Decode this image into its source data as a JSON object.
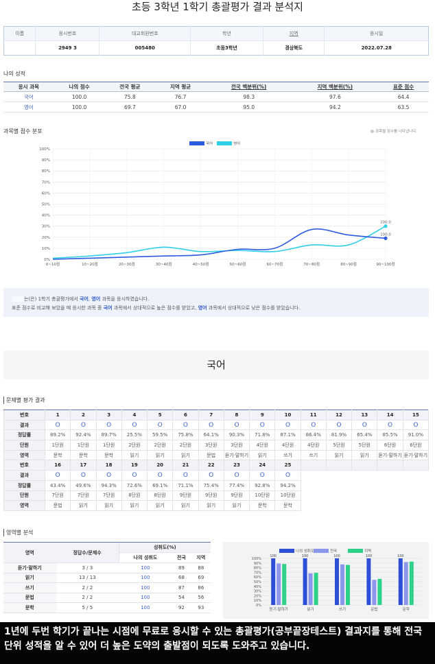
{
  "page_title": "초등 3학년 1학기 총괄평가 결과 분석지",
  "student_info": {
    "headers": [
      "이름",
      "응시번호",
      "대교회원번호",
      "학년",
      "지역",
      "응시일"
    ],
    "values": [
      "",
      "2949 3",
      "005480",
      "초등3학년",
      "경상북도",
      "2022.07.28"
    ]
  },
  "my_scores": {
    "label": "나의 성적",
    "headers": [
      "응시 과목",
      "나의 점수",
      "전국 평균",
      "지역 평균",
      "전국 백분위(%)",
      "지역 백분위(%)",
      "표준 점수"
    ],
    "rows": [
      [
        "국어",
        "100.0",
        "75.8",
        "76.7",
        "98.3",
        "97.6",
        "64.4"
      ],
      [
        "영어",
        "100.0",
        "69.7",
        "67.0",
        "95.0",
        "94.2",
        "63.5"
      ]
    ]
  },
  "distribution": {
    "label": "과목별 점수 분포",
    "note": "과목별 점수를 나타냅니다."
  },
  "chart_data": {
    "type": "line",
    "title": "",
    "categories": [
      "0~10점",
      "10~20점",
      "20~30점",
      "30~40점",
      "40~50점",
      "50~60점",
      "60~70점",
      "70~80점",
      "80~90점",
      "90~100점"
    ],
    "y_ticks": [
      "0%",
      "10%",
      "20%",
      "30%",
      "40%",
      "50%",
      "60%",
      "70%",
      "80%",
      "90%",
      "100%"
    ],
    "ylim": [
      0,
      100
    ],
    "grid": true,
    "legend": "top-center",
    "series": [
      {
        "name": "국어",
        "color": "#2d5be0",
        "values": [
          0,
          1,
          2,
          3,
          4,
          9,
          10,
          27,
          22,
          19
        ],
        "end_label": "100.0"
      },
      {
        "name": "영어",
        "color": "#30cfe8",
        "values": [
          1,
          3,
          6,
          11,
          7,
          8,
          7,
          13,
          13,
          30
        ],
        "end_label": "100.0"
      }
    ]
  },
  "summary": {
    "line1_a": "는(은) 1학기 총괄평가에서 ",
    "line1_s1": "국어",
    "line1_sep": ", ",
    "line1_s2": "영어",
    "line1_b": " 과목을 응시하였습니다.",
    "line2_a": "표준 점수로 비교해 보았을 때 응시한 과목 중 ",
    "line2_s1": "국어",
    "line2_b": " 과목에서 상대적으로 높은 점수를 받았고, ",
    "line2_s2": "영어",
    "line2_c": " 과목에서 상대적으로 낮은 점수를 받았습니다."
  },
  "subject_title": "국어",
  "problem_section": {
    "label": "문제별 평가 결과",
    "row_headers": [
      "번호",
      "결과",
      "정답률",
      "단원",
      "영역"
    ],
    "block1": {
      "numbers": [
        "1",
        "2",
        "3",
        "4",
        "5",
        "6",
        "7",
        "8",
        "9",
        "10",
        "11",
        "12",
        "13",
        "14",
        "15"
      ],
      "results": [
        "O",
        "O",
        "O",
        "O",
        "O",
        "O",
        "O",
        "O",
        "O",
        "O",
        "O",
        "O",
        "O",
        "O",
        "O"
      ],
      "rates": [
        "89.2%",
        "92.4%",
        "89.7%",
        "25.5%",
        "59.5%",
        "75.8%",
        "64.1%",
        "90.3%",
        "71.8%",
        "87.1%",
        "86.4%",
        "81.9%",
        "65.4%",
        "85.5%",
        "91.0%"
      ],
      "units": [
        "1단원",
        "1단원",
        "1단원",
        "2단원",
        "2단원",
        "2단원",
        "3단원",
        "3단원",
        "4단원",
        "4단원",
        "4단원",
        "5단원",
        "5단원",
        "6단원",
        "6단원"
      ],
      "areas": [
        "문학",
        "문학",
        "문학",
        "읽기",
        "읽기",
        "읽기",
        "문법",
        "듣기·말하기",
        "읽기",
        "쓰기",
        "쓰기",
        "읽기",
        "읽기",
        "듣기·말하기",
        "듣기·말하기"
      ]
    },
    "block2": {
      "numbers": [
        "16",
        "17",
        "18",
        "19",
        "20",
        "21",
        "22",
        "23",
        "24",
        "25"
      ],
      "results": [
        "O",
        "O",
        "O",
        "O",
        "O",
        "O",
        "O",
        "O",
        "O",
        "O"
      ],
      "rates": [
        "43.4%",
        "49.6%",
        "94.3%",
        "72.6%",
        "69.1%",
        "71.1%",
        "75.4%",
        "77.4%",
        "92.8%",
        "94.2%"
      ],
      "units": [
        "7단원",
        "7단원",
        "7단원",
        "8단원",
        "8단원",
        "9단원",
        "9단원",
        "9단원",
        "10단원",
        "10단원"
      ],
      "areas": [
        "문법",
        "읽기",
        "읽기",
        "읽기",
        "읽기",
        "읽기",
        "읽기",
        "읽기",
        "문학",
        "문학"
      ]
    }
  },
  "area_section": {
    "label": "영역별 분석",
    "header_area": "영역",
    "header_ratio": "정답수/문제수",
    "header_group": "성취도(%)",
    "sub_headers": [
      "나의 성취도",
      "전국",
      "지역"
    ],
    "rows": [
      [
        "듣기·말하기",
        "3 / 3",
        "100",
        "89",
        "88"
      ],
      [
        "읽기",
        "13 / 13",
        "100",
        "68",
        "69"
      ],
      [
        "쓰기",
        "2 / 2",
        "100",
        "87",
        "86"
      ],
      [
        "문법",
        "2 / 2",
        "100",
        "54",
        "56"
      ],
      [
        "문학",
        "5 / 5",
        "100",
        "92",
        "93"
      ]
    ]
  },
  "area_chart": {
    "legend": [
      "나의 성취도",
      "전국",
      "지역"
    ],
    "colors": [
      "#2d4fd8",
      "#8c96ea",
      "#2fd188"
    ],
    "categories": [
      "듣기·말하기",
      "읽기",
      "쓰기",
      "문법",
      "문학"
    ],
    "y_ticks": [
      "0%",
      "10%",
      "20%",
      "30%",
      "40%",
      "50%",
      "60%",
      "70%",
      "80%",
      "90%",
      "100%"
    ],
    "series_values": [
      [
        100,
        100,
        100,
        100,
        100
      ],
      [
        89,
        68,
        87,
        54,
        92
      ],
      [
        88,
        69,
        86,
        56,
        93
      ]
    ],
    "top_label": "100"
  },
  "caption": "1년에 두번 학기가 끝나는 시점에 무료로 응시할 수 있는 총괄평가(공부끝장테스트) 결과지를 통해 전국 단위 성적을 알 수 있어 더 높은 도약의 출발점이 되도록 도와주고 있습니다."
}
